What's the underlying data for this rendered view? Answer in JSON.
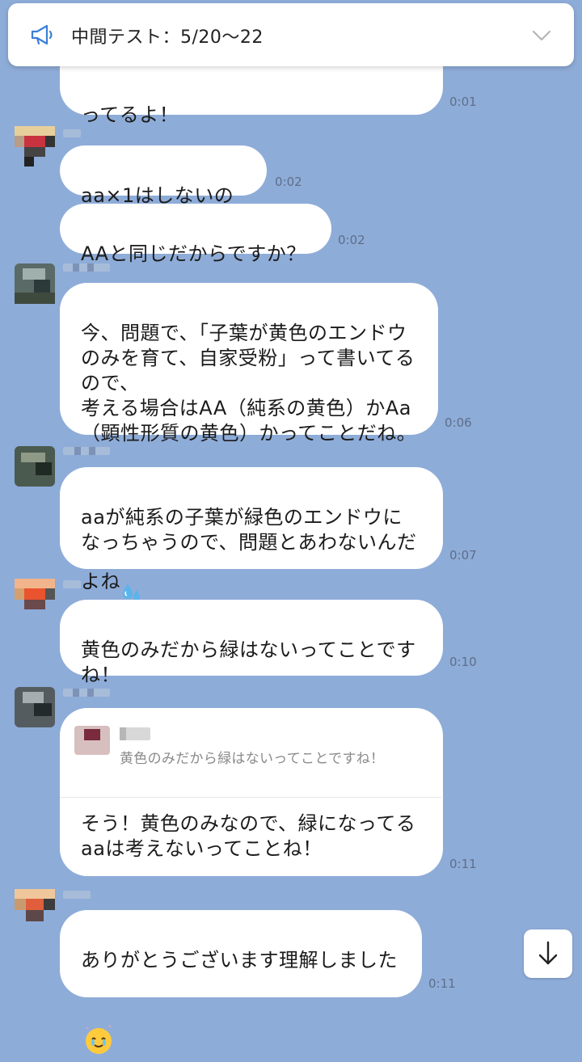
{
  "announcement": {
    "text": "中間テスト：5/20～22",
    "icon": "megaphone-icon",
    "expand_icon": "chevron-down-icon"
  },
  "messages": [
    {
      "text": "ってるよ！",
      "time": "0:01"
    },
    {
      "text": "aa×1はしないのは",
      "time": "0:02"
    },
    {
      "text": "AAと同じだからですか？",
      "time": "0:02"
    },
    {
      "text": "今、問題で、「子葉が黄色のエンドウ\nのみを育て、自家受粉」って書いてる\nので、\n考える場合はAA（純系の黄色）かAa\n（顕性形質の黄色）かってことだね。",
      "time": "0:06"
    },
    {
      "text": "aaが純系の子葉が緑色のエンドウに\nなっちゃうので、問題とあわないんだ\nよね",
      "time": "0:07",
      "emoji": "sweat-droplets-emoji"
    },
    {
      "text": "黄色のみだから緑はないってことです\nね！",
      "time": "0:10"
    },
    {
      "quote": "黄色のみだから緑はないってことですね！",
      "text": "そう！黄色のみなので、緑になってる\naaは考えないってことね！",
      "time": "0:11"
    },
    {
      "text": "ありがとうございます理解しました",
      "time": "0:11",
      "emoji": "grateful-face-emoji"
    }
  ],
  "scroll_button": {
    "icon": "arrow-down-icon"
  },
  "colors": {
    "background": "#8eacd8",
    "bubble": "#ffffff",
    "time": "#5e6e88"
  }
}
